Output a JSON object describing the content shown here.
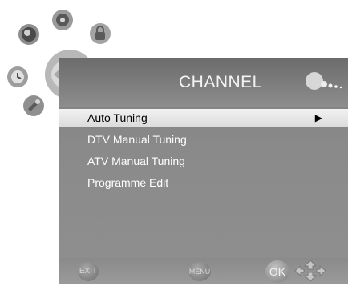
{
  "menu": {
    "title": "CHANNEL",
    "items": [
      {
        "label": "Auto Tuning",
        "selected": true,
        "indicator": "▶"
      },
      {
        "label": "DTV Manual Tuning",
        "selected": false
      },
      {
        "label": "ATV Manual Tuning",
        "selected": false
      },
      {
        "label": "Programme Edit",
        "selected": false
      }
    ]
  },
  "footer": {
    "exit_label": "EXIT",
    "menu_label": "MENU",
    "ok_label": "OK",
    "navigation_icon": "four-way-arrow-icon"
  },
  "decorative_icons": [
    "picture-icon",
    "sound-icon",
    "lock-icon",
    "clock-icon",
    "setup-icon",
    "channel-dish-icon"
  ],
  "colors": {
    "panel": "#8a8a8a",
    "selection_bar": "#e8e8e8",
    "text": "#ffffff"
  }
}
